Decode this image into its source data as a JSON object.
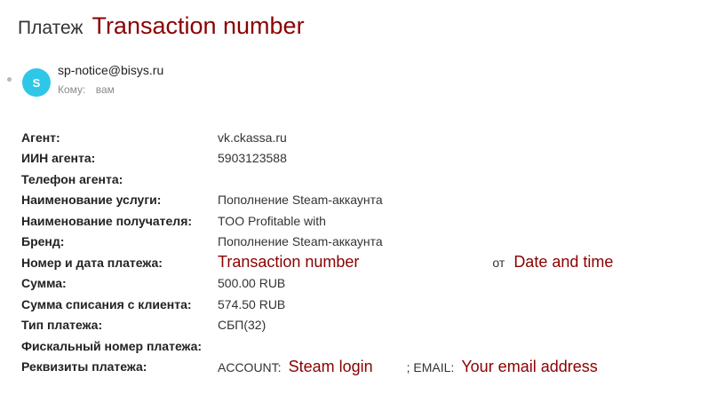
{
  "subject": {
    "title": "Платеж",
    "annotation": "Transaction number"
  },
  "sender": {
    "avatar_letter": "S",
    "email": "sp-notice@bisys.ru",
    "to_label": "Кому:",
    "to_value": "вам"
  },
  "colors": {
    "avatar": "#2fc7e8",
    "annotation": "#8b0000"
  },
  "details": {
    "agent": {
      "label": "Агент:",
      "value": "vk.ckassa.ru"
    },
    "agent_iin": {
      "label": "ИИН агента:",
      "value": "5903123588"
    },
    "agent_phone": {
      "label": "Телефон агента:",
      "value": ""
    },
    "service_name": {
      "label": "Наименование услуги:",
      "value": "Пополнение Steam-аккаунта"
    },
    "recipient_name": {
      "label": "Наименование получателя:",
      "value": "TOO Profitable with"
    },
    "brand": {
      "label": "Бренд:",
      "value": "Пополнение Steam-аккаунта"
    },
    "payment_number_date": {
      "label": "Номер и дата платежа:",
      "annot_number": "Transaction number",
      "connector": "от",
      "annot_date": "Date and time"
    },
    "amount": {
      "label": "Сумма:",
      "value": "500.00 RUB"
    },
    "amount_charged": {
      "label": "Сумма списания с клиента:",
      "value": "574.50 RUB"
    },
    "payment_type": {
      "label": "Тип платежа:",
      "value": "СБП(32)"
    },
    "fiscal_number": {
      "label": "Фискальный номер платежа:",
      "value": ""
    },
    "requisites": {
      "label": "Реквизиты платежа:",
      "account_prefix": "ACCOUNT:",
      "annot_login": "Steam login",
      "email_prefix": "; EMAIL:",
      "annot_email": "Your email address"
    }
  }
}
